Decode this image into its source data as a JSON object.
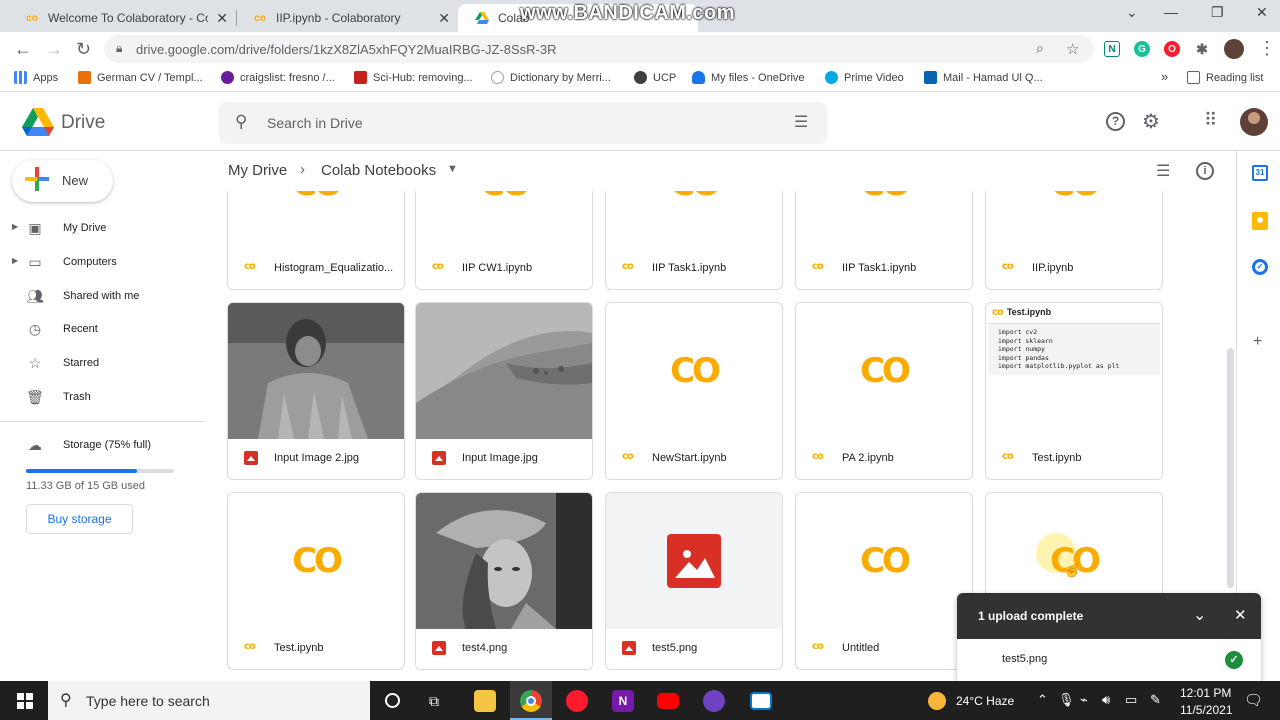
{
  "browser": {
    "tabs": [
      {
        "title": "Welcome To Colaboratory - Colal",
        "favicon": "colab-icon",
        "active": false
      },
      {
        "title": "IIP.ipynb - Colaboratory",
        "favicon": "colab-icon",
        "active": false
      },
      {
        "title": "Colab",
        "favicon": "drive-icon",
        "active": true
      }
    ],
    "watermark": "www.BANDICAM.com",
    "url": "drive.google.com/drive/folders/1kzX8ZlA5xhFQY2MuaIRBG-JZ-8SsR-3R",
    "bookmarks": [
      {
        "label": "Apps",
        "color": "#5f6368"
      },
      {
        "label": "German CV / Templ...",
        "color": "#e8710a"
      },
      {
        "label": "craigslist: fresno /...",
        "color": "#6a1b9a"
      },
      {
        "label": "Sci-Hub: removing...",
        "color": "#c5221f"
      },
      {
        "label": "Dictionary by Merri...",
        "color": "#9aa0a6"
      },
      {
        "label": "UCP",
        "color": "#3c4043"
      },
      {
        "label": "My files - OneDrive",
        "color": "#1a73e8"
      },
      {
        "label": "Prime Video",
        "color": "#00a8e1"
      },
      {
        "label": "Mail - Hamad Ul Q...",
        "color": "#0a64ad"
      }
    ],
    "overflow": "»",
    "reading_list": "Reading list"
  },
  "drive": {
    "app_name": "Drive",
    "search_placeholder": "Search in Drive",
    "new_label": "New",
    "nav": [
      {
        "label": "My Drive",
        "icon": "my-drive-icon",
        "expand": true
      },
      {
        "label": "Computers",
        "icon": "computers-icon",
        "expand": true
      },
      {
        "label": "Shared with me",
        "icon": "shared-icon",
        "expand": false
      },
      {
        "label": "Recent",
        "icon": "clock-icon",
        "expand": false
      },
      {
        "label": "Starred",
        "icon": "star-icon",
        "expand": false
      },
      {
        "label": "Trash",
        "icon": "trash-icon",
        "expand": false
      }
    ],
    "storage": {
      "label": "Storage (75% full)",
      "used_text": "11.33 GB of 15 GB used",
      "fraction": 0.75
    },
    "buy_storage": "Buy storage",
    "breadcrumb": {
      "root": "My Drive",
      "current": "Colab Notebooks"
    },
    "files": [
      {
        "name": "Histogram_Equalizatio...",
        "type": "colab",
        "thumb": "colab-partial"
      },
      {
        "name": "IIP CW1.ipynb",
        "type": "colab",
        "thumb": "colab-partial"
      },
      {
        "name": "IIP Task1.ipynb",
        "type": "colab",
        "thumb": "colab-partial"
      },
      {
        "name": "IIP Task1.ipynb",
        "type": "colab",
        "thumb": "colab-partial"
      },
      {
        "name": "IIP.ipynb",
        "type": "colab",
        "thumb": "colab-partial"
      },
      {
        "name": "Input Image 2.jpg",
        "type": "image",
        "thumb": "photo-child"
      },
      {
        "name": "Input Image.jpg",
        "type": "image",
        "thumb": "photo-landscape"
      },
      {
        "name": "NewStart.ipynb",
        "type": "colab",
        "thumb": "colab"
      },
      {
        "name": "PA 2.ipynb",
        "type": "colab",
        "thumb": "colab"
      },
      {
        "name": "Test.ipynb",
        "type": "colab",
        "thumb": "code"
      },
      {
        "name": "Test.ipynb",
        "type": "colab",
        "thumb": "colab"
      },
      {
        "name": "test4.png",
        "type": "image",
        "thumb": "photo-lena"
      },
      {
        "name": "test5.png",
        "type": "image",
        "thumb": "image-placeholder"
      },
      {
        "name": "Untitled",
        "type": "colab",
        "thumb": "colab"
      },
      {
        "name": "",
        "type": "colab",
        "thumb": "colab-hover"
      }
    ],
    "code_preview": {
      "title": "Test.ipynb",
      "lines": [
        "import cv2",
        "import sklearn",
        "import numpy",
        "import pandas",
        "import matplotlib.pyplot as plt"
      ]
    },
    "colab_logo_text": "CO",
    "upload_toast": {
      "title": "1 upload complete",
      "file": "test5.png",
      "status": "complete"
    }
  },
  "taskbar": {
    "search_placeholder": "Type here to search",
    "weather": "24°C  Haze",
    "time": "12:01 PM",
    "date": "11/5/2021"
  }
}
